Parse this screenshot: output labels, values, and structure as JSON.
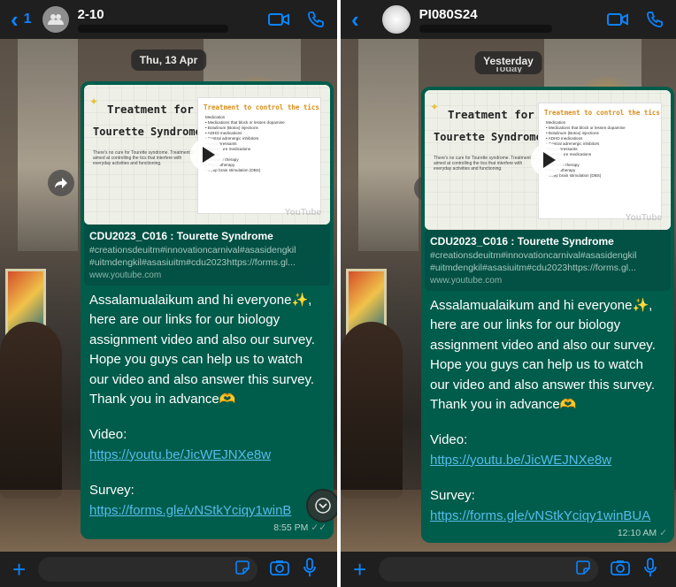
{
  "colors": {
    "accent": "#0a84ff",
    "bubble_out": "#005c4b",
    "link": "#53bdeb"
  },
  "left": {
    "header": {
      "back_count": "1",
      "title": "2-10",
      "video_icon": "video-camera-icon",
      "call_icon": "phone-icon"
    },
    "date_chip": "Thu, 13 Apr",
    "message": {
      "preview": {
        "title1": "Treatment for",
        "title2": "Tourette Syndrome",
        "body": "There's no cure for Tourette syndrome. Treatment is aimed at controlling the tics that interfere with everyday activities and functioning.",
        "card_title": "Treatment to control the tics",
        "card_list": "Medication\n• Medications that block or lessen dopamine\n• Botulinum (Botox) injections\n• ADHD medications\n• Central adrenergic inhibitors\n• Antidepressants\n• Antiseizure medications\nTherapy\n• Behavior therapy\n• Psychotherapy\n• Deep brain stimulation (DBS)",
        "watermark": "YouTube"
      },
      "link_title": "CDU2023_C016 : Tourette Syndrome",
      "link_desc_1": "#creationsdeuitm#innovationcarnival#asasidengkil",
      "link_desc_2": "#uitmdengkil#asasiuitm#cdu2023https://forms.gl...",
      "link_domain": "www.youtube.com",
      "text_1": "Assalamualaikum and hi everyone",
      "emoji_1": "✨",
      "text_1b": ",",
      "text_2": "here are our links for our biology",
      "text_3": "assignment video and also our survey.",
      "text_4": "Hope you guys can help us to watch",
      "text_5": "our video and also answer this survey.",
      "text_6": "Thank you in advance",
      "emoji_2": "🫶",
      "video_label": "Video:",
      "video_link": "https://youtu.be/JicWEJNXe8w",
      "survey_label": "Survey:",
      "survey_link": "https://forms.gle/vNStkYciqy1winB",
      "time": "8:55 PM"
    }
  },
  "right": {
    "header": {
      "title": "PI080S24",
      "video_icon": "video-camera-icon",
      "call_icon": "phone-icon"
    },
    "date_chip": "Yesterday",
    "date_chip_ghost": "Today",
    "message": {
      "survey_link": "https://forms.gle/vNStkYciqy1winBUA",
      "time": "12:10 AM"
    }
  }
}
